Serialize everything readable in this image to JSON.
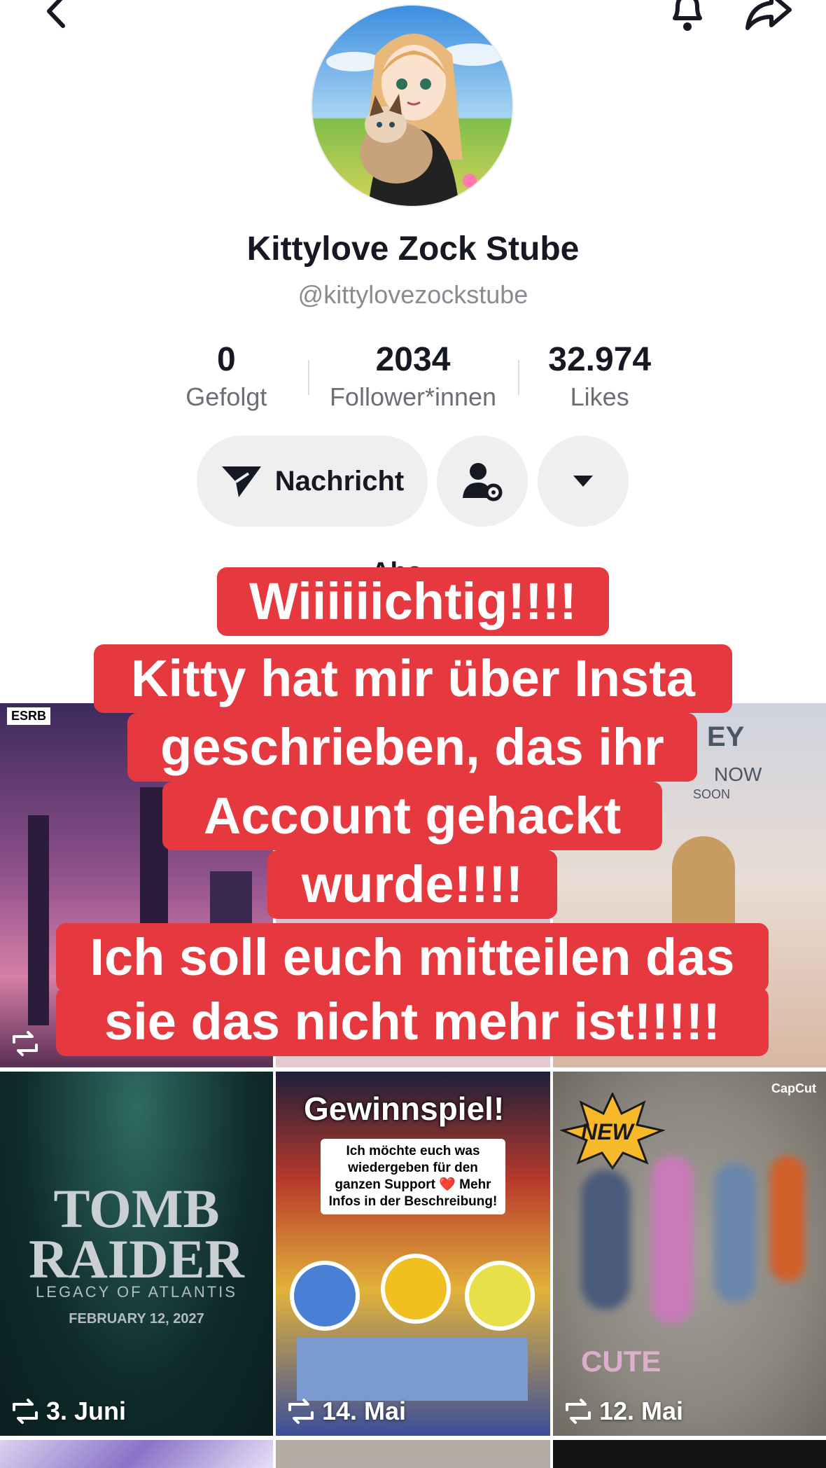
{
  "profile": {
    "display_name": "Kittylove Zock Stube",
    "handle": "@kittylovezockstube"
  },
  "stats": [
    {
      "value": "0",
      "label": "Gefolgt"
    },
    {
      "value": "2034",
      "label": "Follower*innen"
    },
    {
      "value": "32.974",
      "label": "Likes"
    }
  ],
  "actions": {
    "message_label": "Nachricht"
  },
  "tab_peek": "Abo",
  "overlay_lines": [
    "Wiiiiiichtig!!!!",
    "Kitty hat mir über Insta",
    "geschrieben, das ihr",
    "Account gehackt",
    "wurde!!!!",
    "Ich soll euch mitteilen das",
    "sie das nicht mehr ist!!!!!"
  ],
  "videos": [
    {
      "caption": "TOMB RAIDER",
      "subtitle": "LEGACY OF ATLANTIS",
      "date_line": "FEBRUARY 12, 2027",
      "date": "3. Juni"
    },
    {
      "caption": "Gewinnspiel!",
      "subtitle": "Ich möchte euch was wiedergeben für den ganzen Support ❤️ Mehr Infos in der Beschreibung!",
      "date": "14. Mai"
    },
    {
      "caption": "NEW",
      "subtitle": "CUTE",
      "badge": "CapCut",
      "date": "12. Mai"
    }
  ],
  "top_row_labels": {
    "esrb": "ESRB",
    "right_text_1": "EY",
    "right_text_2": "NOW",
    "right_text_3": "SOON"
  },
  "colors": {
    "overlay_red": "#e5393f",
    "button_grey": "#efefef"
  }
}
